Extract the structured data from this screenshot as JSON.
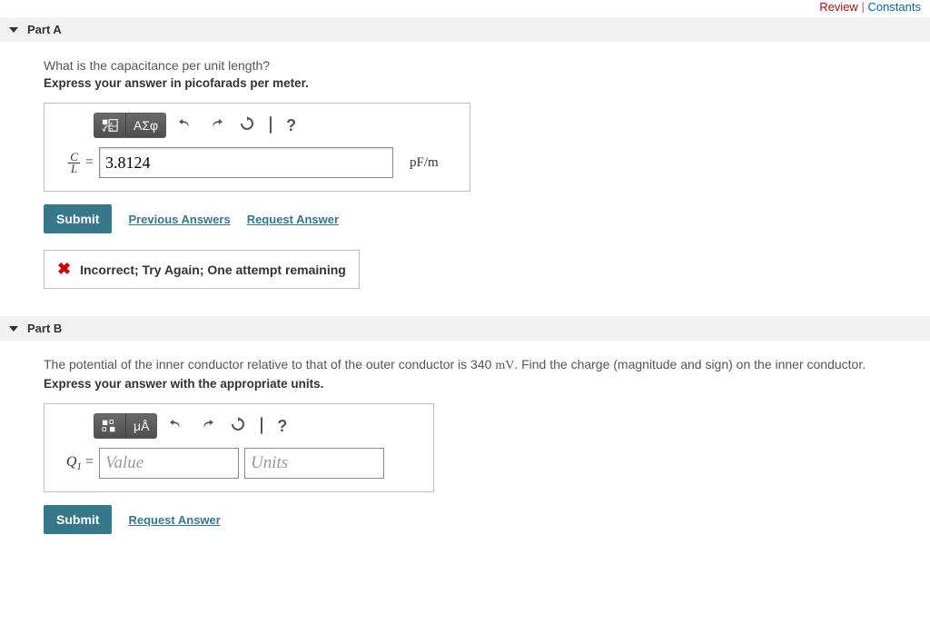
{
  "topLinks": {
    "review": "Review",
    "sep": "|",
    "constants": "Constants"
  },
  "partA": {
    "title": "Part A",
    "question": "What is the capacitance per unit length?",
    "instruct": "Express your answer in picofarads per meter.",
    "greekBtn": "ΑΣφ",
    "varNum": "C",
    "varDen": "L",
    "eq": " = ",
    "value": "3.8124",
    "unit": "pF/m",
    "submit": "Submit",
    "prevAnswers": "Previous Answers",
    "reqAnswer": "Request Answer",
    "feedback": "Incorrect; Try Again; One attempt remaining"
  },
  "partB": {
    "title": "Part B",
    "question": "The potential of the inner conductor relative to that of the outer conductor is 340 mV. Find the charge (magnitude and sign) on the inner conductor.",
    "instruct": "Express your answer with the appropriate units.",
    "unitsBtn": "μÅ",
    "varLabel": "Q",
    "varSub": "1",
    "eq": " = ",
    "valuePlaceholder": "Value",
    "unitsPlaceholder": "Units",
    "submit": "Submit",
    "reqAnswer": "Request Answer"
  }
}
